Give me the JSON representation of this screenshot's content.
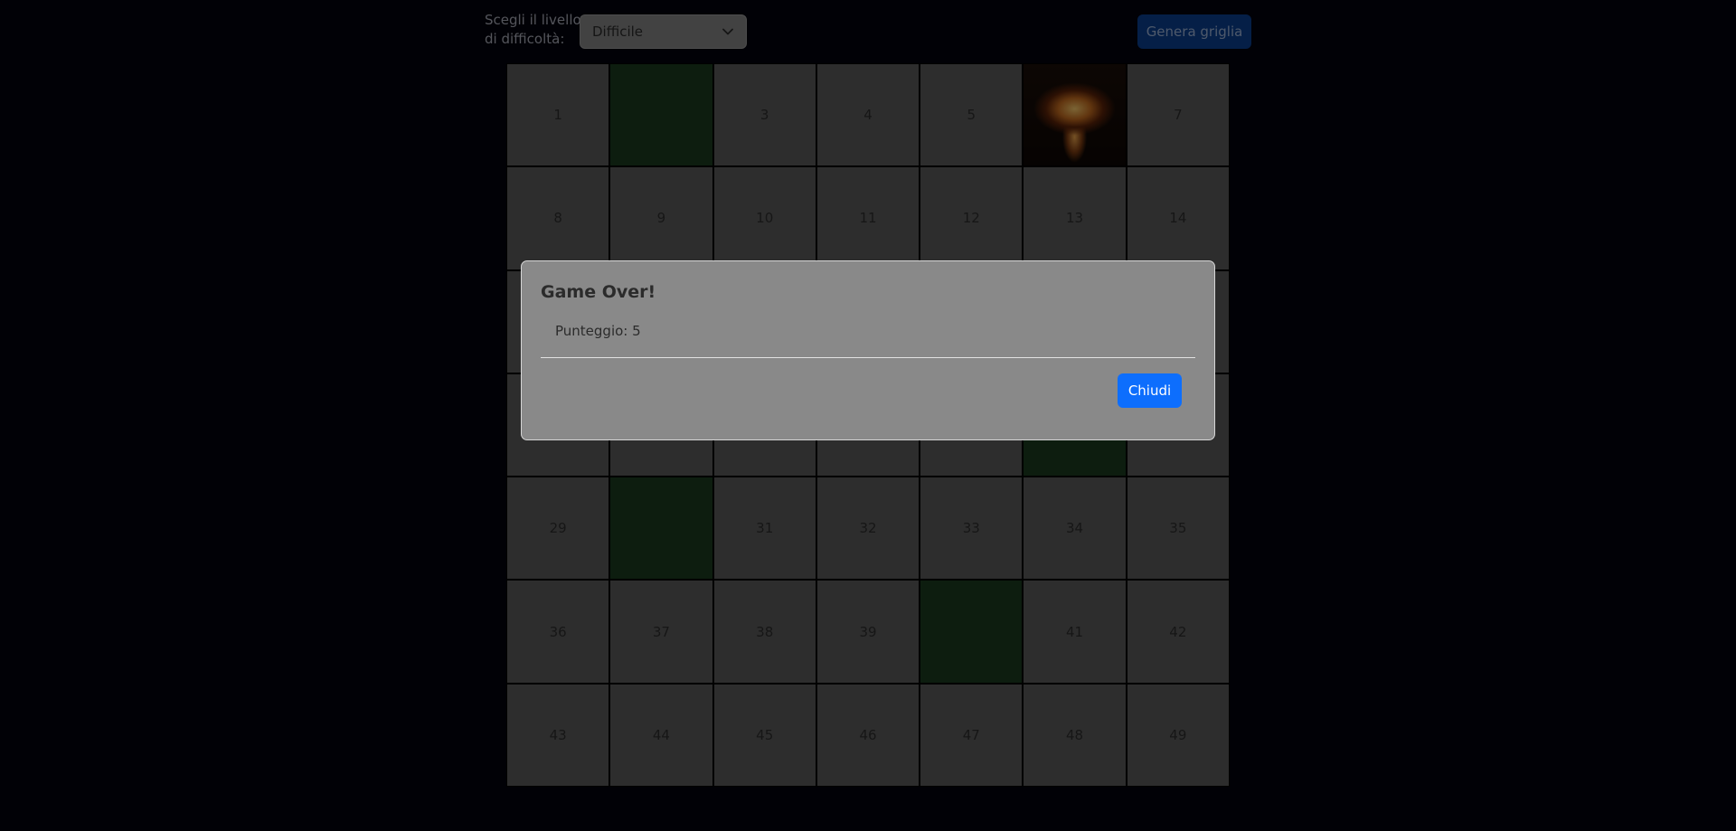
{
  "controls": {
    "level_label_line1": "Scegli il livello",
    "level_label_line2": "di difficoltà:",
    "level_selected": "Difficile",
    "generate_label": "Genera griglia"
  },
  "grid": {
    "columns": 7,
    "rows": 7,
    "cells": [
      {
        "label": "1",
        "state": "covered"
      },
      {
        "label": "",
        "state": "safe"
      },
      {
        "label": "3",
        "state": "covered"
      },
      {
        "label": "4",
        "state": "covered"
      },
      {
        "label": "5",
        "state": "covered"
      },
      {
        "label": "",
        "state": "bomb"
      },
      {
        "label": "7",
        "state": "covered"
      },
      {
        "label": "8",
        "state": "covered"
      },
      {
        "label": "9",
        "state": "covered"
      },
      {
        "label": "10",
        "state": "covered"
      },
      {
        "label": "11",
        "state": "covered"
      },
      {
        "label": "12",
        "state": "covered"
      },
      {
        "label": "13",
        "state": "covered"
      },
      {
        "label": "14",
        "state": "covered"
      },
      {
        "label": "",
        "state": "covered"
      },
      {
        "label": "",
        "state": "covered"
      },
      {
        "label": "",
        "state": "covered"
      },
      {
        "label": "",
        "state": "covered"
      },
      {
        "label": "",
        "state": "covered"
      },
      {
        "label": "",
        "state": "covered"
      },
      {
        "label": "",
        "state": "covered"
      },
      {
        "label": "",
        "state": "covered"
      },
      {
        "label": "",
        "state": "covered"
      },
      {
        "label": "",
        "state": "covered"
      },
      {
        "label": "",
        "state": "covered"
      },
      {
        "label": "",
        "state": "covered"
      },
      {
        "label": "",
        "state": "safe"
      },
      {
        "label": "",
        "state": "covered"
      },
      {
        "label": "29",
        "state": "covered"
      },
      {
        "label": "",
        "state": "safe"
      },
      {
        "label": "31",
        "state": "covered"
      },
      {
        "label": "32",
        "state": "covered"
      },
      {
        "label": "33",
        "state": "covered"
      },
      {
        "label": "34",
        "state": "covered"
      },
      {
        "label": "35",
        "state": "covered"
      },
      {
        "label": "36",
        "state": "covered"
      },
      {
        "label": "37",
        "state": "covered"
      },
      {
        "label": "38",
        "state": "covered"
      },
      {
        "label": "39",
        "state": "covered"
      },
      {
        "label": "",
        "state": "safe"
      },
      {
        "label": "41",
        "state": "covered"
      },
      {
        "label": "42",
        "state": "covered"
      },
      {
        "label": "43",
        "state": "covered"
      },
      {
        "label": "44",
        "state": "covered"
      },
      {
        "label": "45",
        "state": "covered"
      },
      {
        "label": "46",
        "state": "covered"
      },
      {
        "label": "47",
        "state": "covered"
      },
      {
        "label": "48",
        "state": "covered"
      },
      {
        "label": "49",
        "state": "covered"
      }
    ]
  },
  "modal": {
    "title": "Game Over!",
    "score_text": "Punteggio: 5",
    "close_label": "Chiudi"
  },
  "colors": {
    "background": "#02030d",
    "cell_covered": "#5b5b5b",
    "cell_safe": "#1a3a1e",
    "accent_blue": "#0d6efd"
  },
  "icons": {
    "select_chevron": "chevron-down-icon",
    "bomb_image": "explosion-image"
  }
}
